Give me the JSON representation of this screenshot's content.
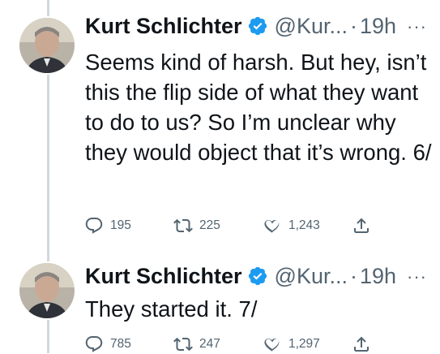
{
  "tweets": [
    {
      "author_name": "Kurt Schlichter",
      "handle": "@Kur...",
      "separator": "·",
      "time": "19h",
      "more": "···",
      "text": "Seems kind of harsh. But hey, isn’t this the flip side of what they want to do to us? So I’m unclear why they would object that it’s wrong. 6/",
      "replies": "195",
      "retweets": "225",
      "likes": "1,243"
    },
    {
      "author_name": "Kurt Schlichter",
      "handle": "@Kur...",
      "separator": "·",
      "time": "19h",
      "more": "···",
      "text": "They started it. 7/",
      "replies": "785",
      "retweets": "247",
      "likes": "1,297"
    }
  ],
  "icons": {
    "verified": "verified-badge-icon",
    "reply": "reply-icon",
    "retweet": "retweet-icon",
    "like": "heart-icon",
    "share": "share-icon"
  },
  "colors": {
    "verified": "#1d9bf0",
    "text": "#0f1419",
    "secondary": "#536471",
    "thread_line": "#cfd9de"
  }
}
